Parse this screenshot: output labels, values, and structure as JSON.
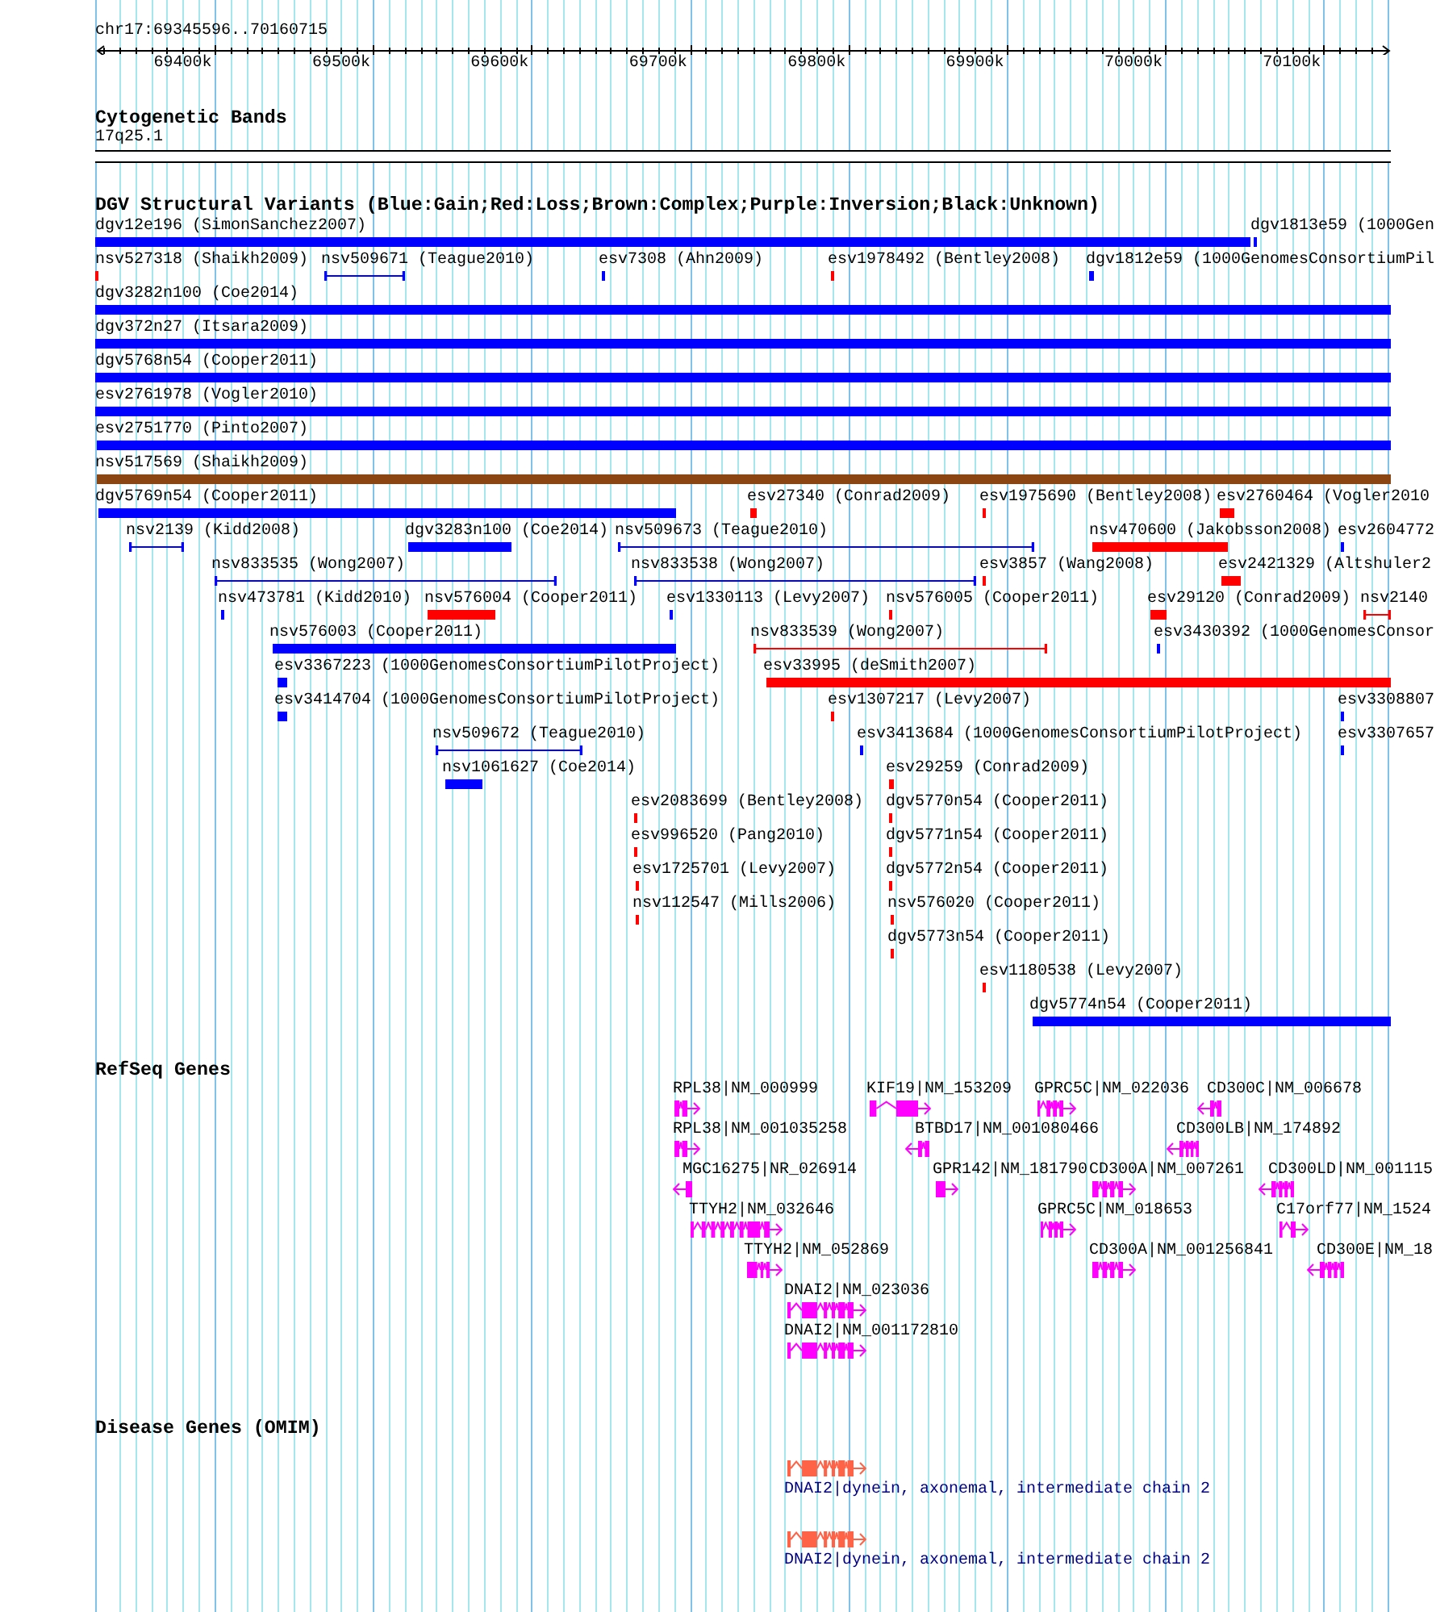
{
  "ruler": {
    "region": "chr17:69345596..70160715",
    "ticks": [
      "69400k",
      "69500k",
      "69600k",
      "69700k",
      "69800k",
      "69900k",
      "70000k",
      "70100k"
    ]
  },
  "cytogenetic_bands": {
    "title": "Cytogenetic Bands",
    "band": "17q25.1"
  },
  "dgv_structural_variants": {
    "title": "DGV Structural Variants (Blue:Gain;Red:Loss;Brown:Complex;Purple:Inversion;Black:Unknown)",
    "rows": [
      {
        "features": [
          {
            "label": "dgv12e196 (SimonSanchez2007)",
            "kind": "bar",
            "color": "#0000ff"
          },
          {
            "label": "dgv1813e59 (1000Gen",
            "kind": "bar",
            "color": "#0000ff"
          }
        ]
      },
      {
        "features": [
          {
            "label": "nsv527318 (Shaikh2009)",
            "kind": "bar",
            "color": "#ff0000"
          },
          {
            "label": "nsv509671 (Teague2010)",
            "kind": "span",
            "color": "#0000ff"
          },
          {
            "label": "esv7308 (Ahn2009)",
            "kind": "bar",
            "color": "#0000ff"
          },
          {
            "label": "esv1978492 (Bentley2008)",
            "kind": "bar",
            "color": "#ff0000"
          },
          {
            "label": "dgv1812e59 (1000GenomesConsortiumPil",
            "kind": "bar",
            "color": "#0000ff"
          }
        ]
      },
      {
        "features": [
          {
            "label": "dgv3282n100 (Coe2014)",
            "kind": "bar",
            "color": "#0000ff"
          }
        ]
      },
      {
        "features": [
          {
            "label": "dgv372n27 (Itsara2009)",
            "kind": "bar",
            "color": "#0000ff"
          }
        ]
      },
      {
        "features": [
          {
            "label": "dgv5768n54 (Cooper2011)",
            "kind": "bar",
            "color": "#0000ff"
          }
        ]
      },
      {
        "features": [
          {
            "label": "esv2761978 (Vogler2010)",
            "kind": "bar",
            "color": "#0000ff"
          }
        ]
      },
      {
        "features": [
          {
            "label": "esv2751770 (Pinto2007)",
            "kind": "bar",
            "color": "#0000ff"
          }
        ]
      },
      {
        "features": [
          {
            "label": "nsv517569 (Shaikh2009)",
            "kind": "bar",
            "color": "#8b4513"
          }
        ]
      },
      {
        "features": [
          {
            "label": "dgv5769n54 (Cooper2011)",
            "kind": "bar",
            "color": "#0000ff"
          },
          {
            "label": "esv27340 (Conrad2009)",
            "kind": "bar",
            "color": "#ff0000"
          },
          {
            "label": "esv1975690 (Bentley2008)",
            "kind": "bar",
            "color": "#ff0000"
          },
          {
            "label": "esv2760464 (Vogler2010",
            "kind": "bar",
            "color": "#ff0000"
          }
        ]
      },
      {
        "features": [
          {
            "label": "nsv2139 (Kidd2008)",
            "kind": "span",
            "color": "#0000ff"
          },
          {
            "label": "dgv3283n100 (Coe2014)",
            "kind": "bar",
            "color": "#0000ff"
          },
          {
            "label": "nsv509673 (Teague2010)",
            "kind": "span",
            "color": "#0000ff"
          },
          {
            "label": "nsv470600 (Jakobsson2008)",
            "kind": "bar",
            "color": "#ff0000"
          },
          {
            "label": "esv2604772",
            "kind": "bar",
            "color": "#0000ff"
          }
        ]
      },
      {
        "features": [
          {
            "label": "nsv833535 (Wong2007)",
            "kind": "span",
            "color": "#0000ff"
          },
          {
            "label": "nsv833538 (Wong2007)",
            "kind": "span",
            "color": "#0000ff"
          },
          {
            "label": "esv3857 (Wang2008)",
            "kind": "bar",
            "color": "#ff0000"
          },
          {
            "label": "esv2421329 (Altshuler2",
            "kind": "bar",
            "color": "#ff0000"
          }
        ]
      },
      {
        "features": [
          {
            "label": "nsv473781 (Kidd2010)",
            "kind": "bar",
            "color": "#0000ff"
          },
          {
            "label": "nsv576004 (Cooper2011)",
            "kind": "bar",
            "color": "#ff0000"
          },
          {
            "label": "esv1330113 (Levy2007)",
            "kind": "bar",
            "color": "#0000ff"
          },
          {
            "label": "nsv576005 (Cooper2011)",
            "kind": "bar",
            "color": "#ff0000"
          },
          {
            "label": "esv29120 (Conrad2009)",
            "kind": "bar",
            "color": "#ff0000"
          },
          {
            "label": "nsv2140",
            "kind": "span",
            "color": "#ff0000"
          }
        ]
      },
      {
        "features": [
          {
            "label": "nsv576003 (Cooper2011)",
            "kind": "bar",
            "color": "#0000ff"
          },
          {
            "label": "nsv833539 (Wong2007)",
            "kind": "span",
            "color": "#ff0000"
          },
          {
            "label": "esv3430392 (1000GenomesConsor",
            "kind": "bar",
            "color": "#0000ff"
          }
        ]
      },
      {
        "features": [
          {
            "label": "esv3367223 (1000GenomesConsortiumPilotProject)",
            "kind": "bar",
            "color": "#0000ff"
          },
          {
            "label": "esv33995 (deSmith2007)",
            "kind": "bar",
            "color": "#ff0000"
          }
        ]
      },
      {
        "features": [
          {
            "label": "esv3414704 (1000GenomesConsortiumPilotProject)",
            "kind": "bar",
            "color": "#0000ff"
          },
          {
            "label": "esv1307217 (Levy2007)",
            "kind": "bar",
            "color": "#ff0000"
          },
          {
            "label": "esv3308807",
            "kind": "bar",
            "color": "#0000ff"
          }
        ]
      },
      {
        "features": [
          {
            "label": "nsv509672 (Teague2010)",
            "kind": "span",
            "color": "#0000ff"
          },
          {
            "label": "esv3413684 (1000GenomesConsortiumPilotProject)",
            "kind": "bar",
            "color": "#0000ff"
          },
          {
            "label": "esv3307657",
            "kind": "bar",
            "color": "#0000ff"
          }
        ]
      },
      {
        "features": [
          {
            "label": "nsv1061627 (Coe2014)",
            "kind": "bar",
            "color": "#0000ff"
          },
          {
            "label": "esv29259 (Conrad2009)",
            "kind": "bar",
            "color": "#ff0000"
          }
        ]
      },
      {
        "features": [
          {
            "label": "esv2083699 (Bentley2008)",
            "kind": "bar",
            "color": "#ff0000"
          },
          {
            "label": "dgv5770n54 (Cooper2011)",
            "kind": "bar",
            "color": "#ff0000"
          }
        ]
      },
      {
        "features": [
          {
            "label": "esv996520 (Pang2010)",
            "kind": "bar",
            "color": "#ff0000"
          },
          {
            "label": "dgv5771n54 (Cooper2011)",
            "kind": "bar",
            "color": "#ff0000"
          }
        ]
      },
      {
        "features": [
          {
            "label": "esv1725701 (Levy2007)",
            "kind": "bar",
            "color": "#ff0000"
          },
          {
            "label": "dgv5772n54 (Cooper2011)",
            "kind": "bar",
            "color": "#ff0000"
          }
        ]
      },
      {
        "features": [
          {
            "label": "nsv112547 (Mills2006)",
            "kind": "bar",
            "color": "#ff0000"
          },
          {
            "label": "nsv576020 (Cooper2011)",
            "kind": "bar",
            "color": "#ff0000"
          }
        ]
      },
      {
        "features": [
          {
            "label": "dgv5773n54 (Cooper2011)",
            "kind": "bar",
            "color": "#ff0000"
          }
        ]
      },
      {
        "features": [
          {
            "label": "esv1180538 (Levy2007)",
            "kind": "bar",
            "color": "#ff0000"
          }
        ]
      },
      {
        "features": [
          {
            "label": "dgv5774n54 (Cooper2011)",
            "kind": "bar",
            "color": "#0000ff"
          }
        ]
      }
    ]
  },
  "refseq_genes": {
    "title": "RefSeq Genes",
    "rows": [
      {
        "genes": [
          {
            "label": "RPL38|NM_000999",
            "reverse_strand": false
          },
          {
            "label": "KIF19|NM_153209",
            "reverse_strand": false
          },
          {
            "label": "GPRC5C|NM_022036",
            "reverse_strand": false
          },
          {
            "label": "CD300C|NM_006678",
            "reverse_strand": true
          }
        ]
      },
      {
        "genes": [
          {
            "label": "RPL38|NM_001035258",
            "reverse_strand": false
          },
          {
            "label": "BTBD17|NM_001080466",
            "reverse_strand": true
          },
          {
            "label": "CD300LB|NM_174892",
            "reverse_strand": true
          }
        ]
      },
      {
        "genes": [
          {
            "label": "MGC16275|NR_026914",
            "reverse_strand": true
          },
          {
            "label": "GPR142|NM_181790",
            "reverse_strand": false
          },
          {
            "label": "CD300A|NM_007261",
            "reverse_strand": false
          },
          {
            "label": "CD300LD|NM_001115",
            "reverse_strand": true
          }
        ]
      },
      {
        "genes": [
          {
            "label": "TTYH2|NM_032646",
            "reverse_strand": false
          },
          {
            "label": "GPRC5C|NM_018653",
            "reverse_strand": false
          },
          {
            "label": "C17orf77|NM_1524",
            "reverse_strand": false
          }
        ]
      },
      {
        "genes": [
          {
            "label": "TTYH2|NM_052869",
            "reverse_strand": false
          },
          {
            "label": "CD300A|NM_001256841",
            "reverse_strand": false
          },
          {
            "label": "CD300E|NM_18",
            "reverse_strand": true
          }
        ]
      },
      {
        "genes": [
          {
            "label": "DNAI2|NM_023036",
            "reverse_strand": false
          }
        ]
      },
      {
        "genes": [
          {
            "label": "DNAI2|NM_001172810",
            "reverse_strand": false
          }
        ]
      }
    ]
  },
  "disease_genes": {
    "title": "Disease Genes (OMIM)",
    "features": [
      {
        "label": "DNAI2|dynein, axonemal, intermediate chain 2",
        "reverse_strand": false
      },
      {
        "label": "DNAI2|dynein, axonemal, intermediate chain 2",
        "reverse_strand": false
      }
    ]
  }
}
